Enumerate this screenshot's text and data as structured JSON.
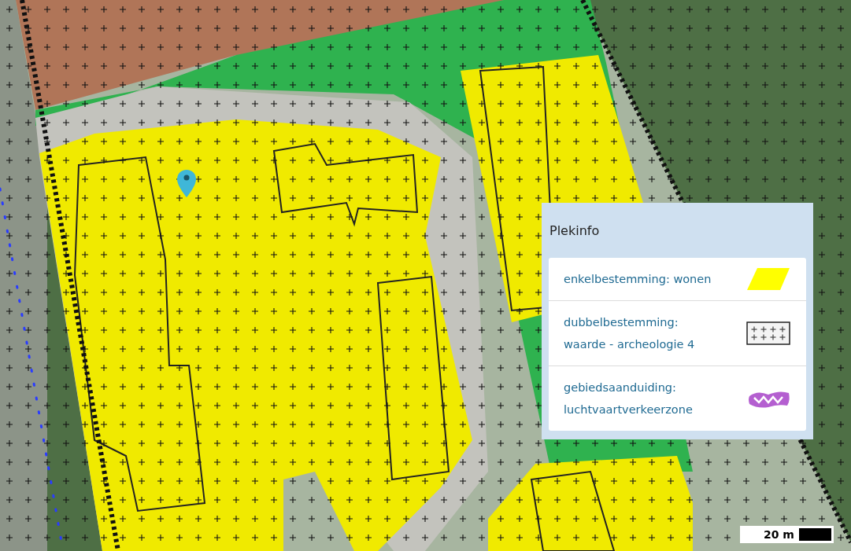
{
  "popup": {
    "title": "Plekinfo",
    "items": [
      {
        "kind": "fill",
        "lines": [
          "enkelbestemming: wonen"
        ]
      },
      {
        "kind": "pattern",
        "lines": [
          "dubbelbestemming:",
          "waarde - archeologie 4"
        ]
      },
      {
        "kind": "zone",
        "lines": [
          "gebiedsaanduiding:",
          "luchtvaartverkeerzone"
        ]
      }
    ]
  },
  "scale_bar": {
    "label": "20 m"
  }
}
